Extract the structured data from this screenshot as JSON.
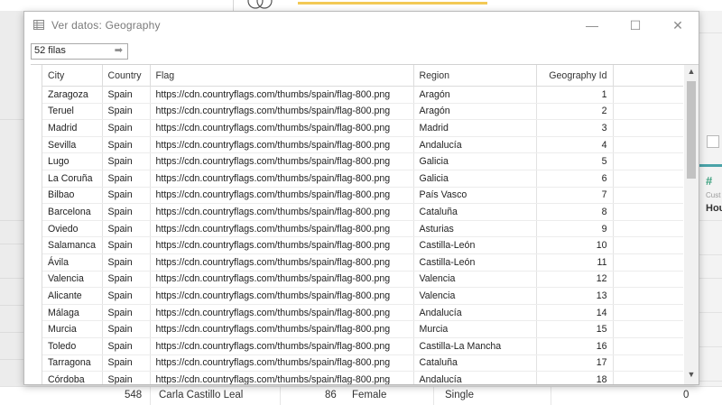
{
  "dialog": {
    "title": "Ver datos:  Geography",
    "rows_count": "52 filas",
    "controls": {
      "minimize": "—",
      "maximize": "☐",
      "close": "✕"
    }
  },
  "table": {
    "columns": [
      "City",
      "Country",
      "Flag",
      "Region",
      "Geography Id"
    ],
    "rows": [
      [
        "Zaragoza",
        "Spain",
        "https://cdn.countryflags.com/thumbs/spain/flag-800.png",
        "Aragón",
        "1"
      ],
      [
        "Teruel",
        "Spain",
        "https://cdn.countryflags.com/thumbs/spain/flag-800.png",
        "Aragón",
        "2"
      ],
      [
        "Madrid",
        "Spain",
        "https://cdn.countryflags.com/thumbs/spain/flag-800.png",
        "Madrid",
        "3"
      ],
      [
        "Sevilla",
        "Spain",
        "https://cdn.countryflags.com/thumbs/spain/flag-800.png",
        "Andalucía",
        "4"
      ],
      [
        "Lugo",
        "Spain",
        "https://cdn.countryflags.com/thumbs/spain/flag-800.png",
        "Galicia",
        "5"
      ],
      [
        "La Coruña",
        "Spain",
        "https://cdn.countryflags.com/thumbs/spain/flag-800.png",
        "Galicia",
        "6"
      ],
      [
        "Bilbao",
        "Spain",
        "https://cdn.countryflags.com/thumbs/spain/flag-800.png",
        "País Vasco",
        "7"
      ],
      [
        "Barcelona",
        "Spain",
        "https://cdn.countryflags.com/thumbs/spain/flag-800.png",
        "Cataluña",
        "8"
      ],
      [
        "Oviedo",
        "Spain",
        "https://cdn.countryflags.com/thumbs/spain/flag-800.png",
        "Asturias",
        "9"
      ],
      [
        "Salamanca",
        "Spain",
        "https://cdn.countryflags.com/thumbs/spain/flag-800.png",
        "Castilla-León",
        "10"
      ],
      [
        "Ávila",
        "Spain",
        "https://cdn.countryflags.com/thumbs/spain/flag-800.png",
        "Castilla-León",
        "11"
      ],
      [
        "Valencia",
        "Spain",
        "https://cdn.countryflags.com/thumbs/spain/flag-800.png",
        "Valencia",
        "12"
      ],
      [
        "Alicante",
        "Spain",
        "https://cdn.countryflags.com/thumbs/spain/flag-800.png",
        "Valencia",
        "13"
      ],
      [
        "Málaga",
        "Spain",
        "https://cdn.countryflags.com/thumbs/spain/flag-800.png",
        "Andalucía",
        "14"
      ],
      [
        "Murcia",
        "Spain",
        "https://cdn.countryflags.com/thumbs/spain/flag-800.png",
        "Murcia",
        "15"
      ],
      [
        "Toledo",
        "Spain",
        "https://cdn.countryflags.com/thumbs/spain/flag-800.png",
        "Castilla-La Mancha",
        "16"
      ],
      [
        "Tarragona",
        "Spain",
        "https://cdn.countryflags.com/thumbs/spain/flag-800.png",
        "Cataluña",
        "17"
      ],
      [
        "Córdoba",
        "Spain",
        "https://cdn.countryflags.com/thumbs/spain/flag-800.png",
        "Andalucía",
        "18"
      ]
    ]
  },
  "background": {
    "right_panel": {
      "hash": "#",
      "caption": "Cust",
      "heading": "Hou"
    },
    "bottom_row": {
      "id": "548",
      "name": "Carla Castillo Leal",
      "age": "86",
      "gender": "Female",
      "status": "Single",
      "value": "0"
    }
  },
  "colors": {
    "accent_teal": "#4aa3a8",
    "accent_yellow": "#f3c955",
    "measure_green": "#3ea17f"
  }
}
